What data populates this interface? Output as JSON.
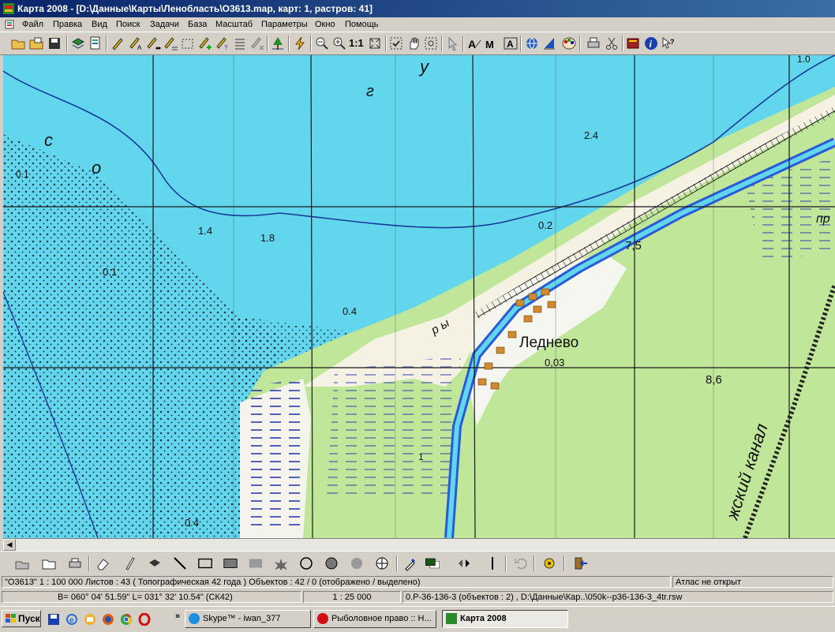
{
  "window": {
    "title": "Карта 2008 - [D:\\Данные\\Карты\\Ленобласть\\O3613.map, карт: 1, растров: 41]"
  },
  "menu": [
    "Файл",
    "Правка",
    "Вид",
    "Поиск",
    "Задачи",
    "База",
    "Масштаб",
    "Параметры",
    "Окно",
    "Помощь"
  ],
  "toolbar": {
    "icons": [
      "open-folder-icon",
      "open-map-icon",
      "save-icon",
      "layers-icon",
      "document-icon",
      "select-pen-icon",
      "select-pen-a-icon",
      "select-pen-dots-icon",
      "select-pen-lines-icon",
      "select-frame-icon",
      "select-add-icon",
      "select-mask-icon",
      "list-icon",
      "deselect-icon",
      "tree-icon",
      "lightning-icon",
      "zoom-out-icon",
      "zoom-in-icon",
      "fit-icon",
      "check-icon",
      "hand-icon",
      "zoom-window-icon",
      "pointer-icon",
      "text-a-icon",
      "text-m-icon",
      "text-box-icon",
      "globe-icon",
      "sail-icon",
      "palette-icon",
      "print-icon",
      "cut-icon",
      "book-icon",
      "info-icon",
      "whats-this-icon"
    ],
    "scale_label": "1:1"
  },
  "map": {
    "labels": {
      "s1": "с",
      "s2": "о",
      "s3": "г",
      "s4": "у",
      "d_2_4": "2.4",
      "d_0_1a": "0.1",
      "d_1_4": "1.4",
      "d_1_8": "1.8",
      "d_0_2": "0.2",
      "d_7_5": "7,5",
      "d_0_1b": "0.1",
      "d_0_4a": "0.4",
      "d_0_03": "0,03",
      "d_8_6": "8,6",
      "d_0_4b": "0.4",
      "d_1_0": "1.0",
      "d_1": "1",
      "village": "Леднево",
      "canal": "жский канал",
      "pr": "пр",
      "yr": "р ы"
    }
  },
  "drawbar": {
    "icons": [
      "edit-object-icon",
      "open-object-icon",
      "print-object-icon",
      "eraser-icon",
      "pencil-icon",
      "brush-icon",
      "line-icon",
      "rectangle-icon",
      "filled-rect-icon",
      "gray-rect-icon",
      "star-icon",
      "circle-icon",
      "filled-circle-icon",
      "gray-circle-icon",
      "crosshair-icon",
      "eyedropper-icon",
      "color-swatch-icon",
      "arrows-icon",
      "vertical-line-icon",
      "undo-icon",
      "gear-icon",
      "exit-icon"
    ]
  },
  "status": {
    "row1": {
      "map_info": "\"O3613\"  1 : 100 000   Листов : 43   ( Топографическая 42 года )  Объектов : 42 / 0 (отображено / выделено)",
      "atlas": "Атлас не открыт"
    },
    "row2": {
      "coords": "B= 060° 04' 51.59\"   L= 031° 32' 10.54\"   (СК42)",
      "scale": "1 : 25 000",
      "sheet": "0.Р-36-136-3  (объектов : 2) , D:\\Данные\\Кар..\\050k--p36-136-3_4tr.rsw"
    }
  },
  "taskbar": {
    "start": "Пуск",
    "tasks": [
      "Skype™ - iwan_377",
      "Рыболовное право :: Н...",
      "Карта 2008"
    ]
  }
}
